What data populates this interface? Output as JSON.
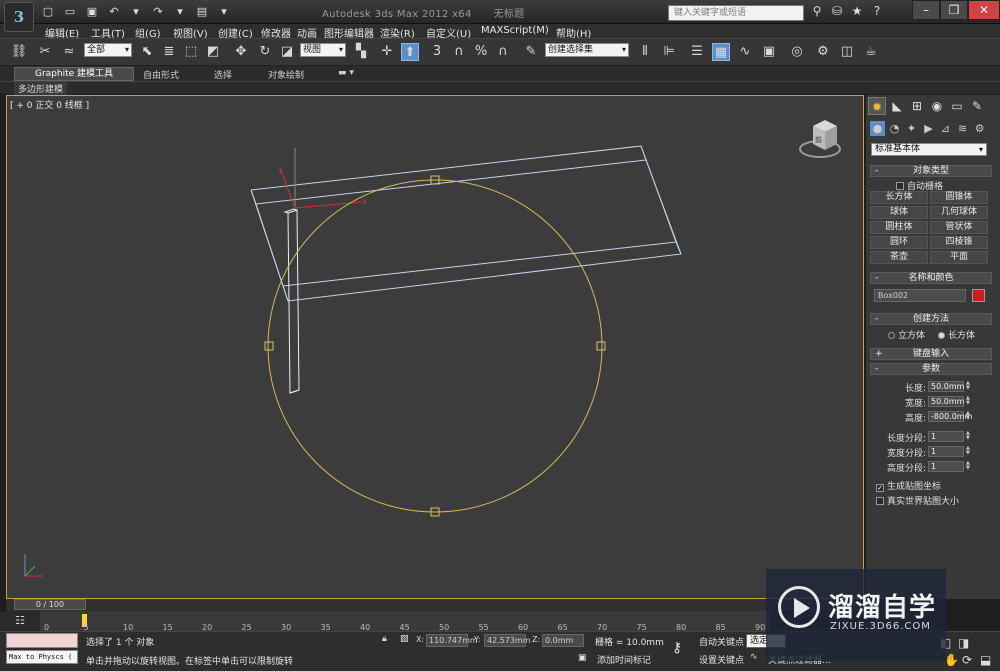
{
  "window": {
    "app_title": "Autodesk 3ds Max  2012 x64",
    "doc_title": "无标题",
    "search_placeholder": "键入关键字或短语",
    "logo_letter": "3"
  },
  "menu": [
    "编辑(E)",
    "工具(T)",
    "组(G)",
    "视图(V)",
    "创建(C)",
    "修改器",
    "动画",
    "图形编辑器",
    "渲染(R)",
    "自定义(U)",
    "MAXScript(M)",
    "帮助(H)"
  ],
  "toolbar": {
    "selection_filter": "全部",
    "ref_coord": "视图",
    "named_selection": "创建选择集",
    "snap_labels": [
      "3",
      "%"
    ]
  },
  "ribbon": {
    "tabs": [
      "Graphite 建模工具",
      "自由形式",
      "选择",
      "对象绘制"
    ],
    "sub_tab": "多边形建模"
  },
  "viewport": {
    "label": "[ + 0 正交 0 线框 ]",
    "viewcube_label": "前"
  },
  "command_panel": {
    "category": "标准基本体",
    "object_type": {
      "header": "对象类型",
      "autogrid": "自动栅格",
      "buttons": [
        "长方体",
        "圆锥体",
        "球体",
        "几何球体",
        "圆柱体",
        "管状体",
        "圆环",
        "四棱锥",
        "茶壶",
        "平面"
      ]
    },
    "name_color": {
      "header": "名称和颜色",
      "name": "Box002",
      "color": "#c4211f"
    },
    "creation_method": {
      "header": "创建方法",
      "options": [
        "立方体",
        "长方体"
      ],
      "selected": "长方体"
    },
    "keyboard_entry": "键盘输入",
    "parameters": {
      "header": "参数",
      "fields": [
        {
          "label": "长度:",
          "value": "50.0mm"
        },
        {
          "label": "宽度:",
          "value": "50.0mm"
        },
        {
          "label": "高度:",
          "value": "-800.0mm"
        },
        {
          "label": "长度分段:",
          "value": "1"
        },
        {
          "label": "宽度分段:",
          "value": "1"
        },
        {
          "label": "高度分段:",
          "value": "1"
        }
      ],
      "gen_mapping": "生成贴图坐标",
      "real_world": "真实世界贴图大小"
    }
  },
  "timeline": {
    "slider_label": "0 / 100",
    "ticks": [
      "0",
      "5",
      "10",
      "15",
      "20",
      "25",
      "30",
      "35",
      "40",
      "45",
      "50",
      "55",
      "60",
      "65",
      "70",
      "75",
      "80",
      "85",
      "90"
    ]
  },
  "status": {
    "maxscript_text": "Max to Physcs (",
    "selection_msg": "选择了 1 个 对象",
    "prompt_msg": "单击并拖动以旋转视图。在标签中单击可以限制旋转",
    "x_label": "X:",
    "x_value": "110.747mm",
    "y_label": "Y:",
    "y_value": "42.573mm",
    "z_label": "Z:",
    "z_value": "0.0mm",
    "grid": "栅格 = 10.0mm",
    "add_time_tag": "添加时间标记",
    "auto_key": "自动关键点",
    "selected": "选定",
    "set_key": "设置关键点",
    "key_filters": "关键点过滤器..."
  },
  "watermark": {
    "title": "溜溜自学",
    "url": "ZIXUE.3D66.COM"
  }
}
